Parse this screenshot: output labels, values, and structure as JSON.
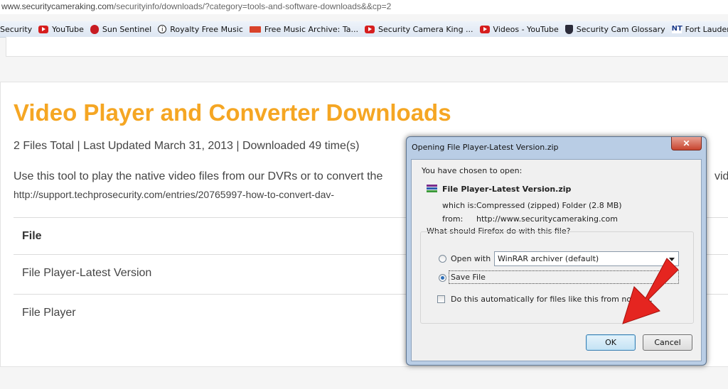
{
  "browser": {
    "url_domain": "www.securitycameraking.com",
    "url_path": "/securityinfo/downloads/?category=tools-and-software-downloads&&cp=2",
    "bookmarks": [
      {
        "label": "Security",
        "icon": "none"
      },
      {
        "label": "YouTube",
        "icon": "youtube-icon"
      },
      {
        "label": "Sun Sentinel",
        "icon": "sun-sentinel-icon"
      },
      {
        "label": "Royalty Free Music",
        "icon": "royalty-free-icon"
      },
      {
        "label": "Free Music Archive: Ta...",
        "icon": "fma-icon"
      },
      {
        "label": "Security Camera King ...",
        "icon": "youtube-icon"
      },
      {
        "label": "Videos - YouTube",
        "icon": "youtube-icon"
      },
      {
        "label": "Security Cam Glossary",
        "icon": "shield-icon"
      },
      {
        "label": "Fort Lauderdale and P...",
        "icon": "nt-icon"
      }
    ]
  },
  "page": {
    "title": "Video Player and Converter Downloads",
    "meta": "2 Files Total | Last Updated March 31, 2013 | Downloaded 49 time(s)",
    "desc_line1": "Use this tool to play the native video files from our DVRs or to convert the",
    "desc_line1_tail": "vide",
    "desc_line2": "http://support.techprosecurity.com/entries/20765997-how-to-convert-dav-",
    "table": {
      "header": "File",
      "rows": [
        "File Player-Latest Version",
        "File Player"
      ]
    },
    "accent_color": "#f5a623"
  },
  "dialog": {
    "title": "Opening File Player-Latest Version.zip",
    "close_glyph": "✕",
    "chosen_label": "You have chosen to open:",
    "filename": "File Player-Latest Version.zip",
    "which_is_label": "which is:",
    "which_is_value": "Compressed (zipped) Folder (2.8 MB)",
    "from_label": "from:",
    "from_value": "http://www.securitycameraking.com",
    "question": "What should Firefox do with this file?",
    "open_with_label": "Open with",
    "open_with_value": "WinRAR archiver (default)",
    "save_file_label": "Save File",
    "auto_label": "Do this automatically for files like this from now on.",
    "ok_label": "OK",
    "cancel_label": "Cancel",
    "selected_option": "Save File"
  }
}
